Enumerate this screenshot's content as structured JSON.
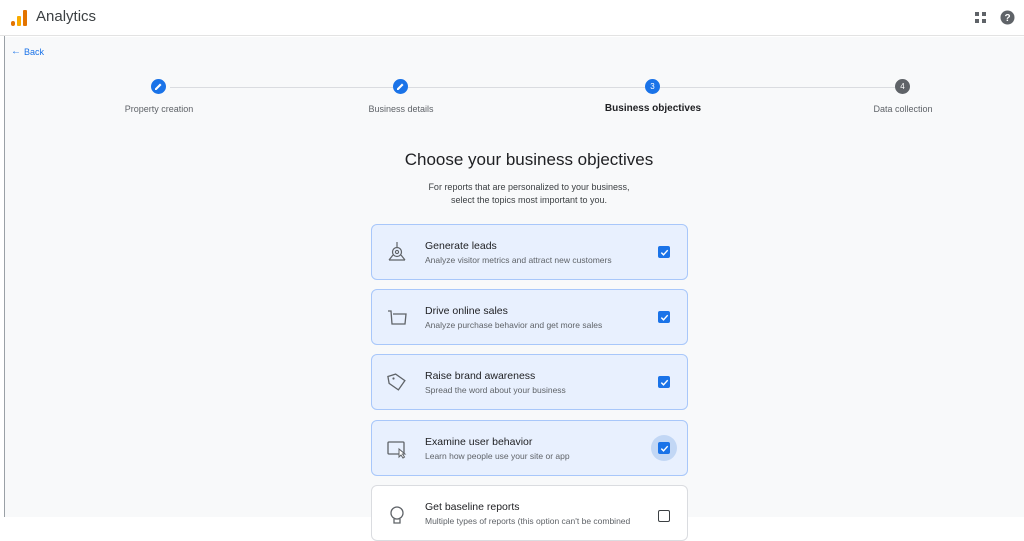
{
  "header": {
    "app_title": "Analytics",
    "logo_icon": "analytics-logo",
    "apps_icon": "apps-grid-icon",
    "help_icon": "help-icon"
  },
  "nav": {
    "back_label": "Back",
    "back_arrow": "←"
  },
  "stepper": {
    "steps": [
      {
        "label": "Property creation",
        "state": "done",
        "marker": ""
      },
      {
        "label": "Business details",
        "state": "done",
        "marker": ""
      },
      {
        "label": "Business objectives",
        "state": "active",
        "marker": "3"
      },
      {
        "label": "Data collection",
        "state": "pending",
        "marker": "4"
      }
    ]
  },
  "content": {
    "heading": "Choose your business objectives",
    "subtext_line1": "For reports that are personalized to your business,",
    "subtext_line2": "select the topics most important to you."
  },
  "objectives": [
    {
      "title": "Generate leads",
      "description": "Analyze visitor metrics and attract new customers",
      "checked": true,
      "icon": "leads-icon"
    },
    {
      "title": "Drive online sales",
      "description": "Analyze purchase behavior and get more sales",
      "checked": true,
      "icon": "cart-icon"
    },
    {
      "title": "Raise brand awareness",
      "description": "Spread the word about your business",
      "checked": true,
      "icon": "tag-icon"
    },
    {
      "title": "Examine user behavior",
      "description": "Learn how people use your site or app",
      "checked": true,
      "icon": "cursor-window-icon"
    },
    {
      "title": "Get baseline reports",
      "description": "Multiple types of reports (this option can't be combined",
      "checked": false,
      "icon": "baseline-icon"
    }
  ],
  "colors": {
    "accent": "#1a73e8",
    "card_selected_bg": "#e8f0fe",
    "card_selected_border": "#a8c7fa",
    "page_bg": "#f8f9fa"
  }
}
